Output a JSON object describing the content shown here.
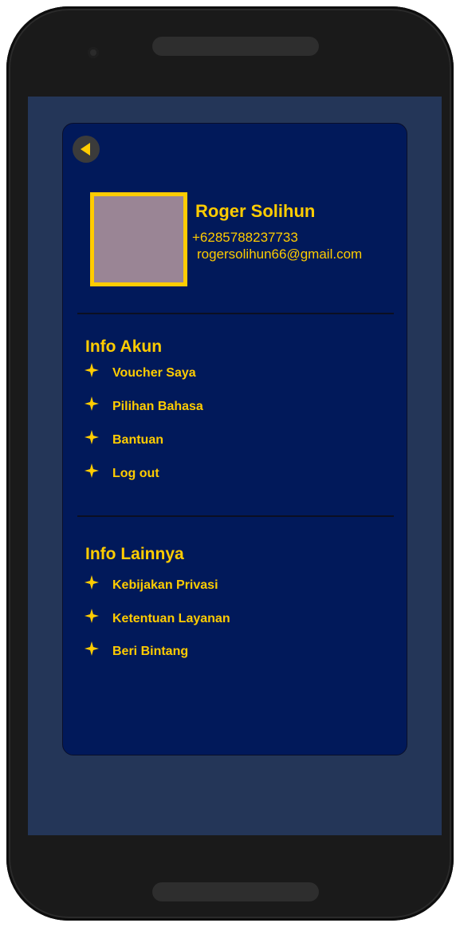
{
  "colors": {
    "accent": "#ffcc00",
    "card_background": "#01195a",
    "screen_background": "#243658",
    "avatar_fill": "#9a8595",
    "phone_body": "#1a1a1a"
  },
  "header": {
    "back_icon": "back-arrow-icon"
  },
  "profile": {
    "name": "Roger Solihun",
    "phone": "+6285788237733",
    "email": "rogersolihun66@gmail.com"
  },
  "account_section": {
    "title": "Info Akun",
    "icon": "star-icon",
    "items": [
      {
        "label": "Voucher Saya"
      },
      {
        "label": "Pilihan Bahasa"
      },
      {
        "label": "Bantuan"
      },
      {
        "label": "Log out"
      }
    ]
  },
  "other_section": {
    "title": "Info Lainnya",
    "icon": "star-icon",
    "items": [
      {
        "label": "Kebijakan Privasi"
      },
      {
        "label": "Ketentuan Layanan"
      },
      {
        "label": "Beri Bintang"
      }
    ]
  }
}
